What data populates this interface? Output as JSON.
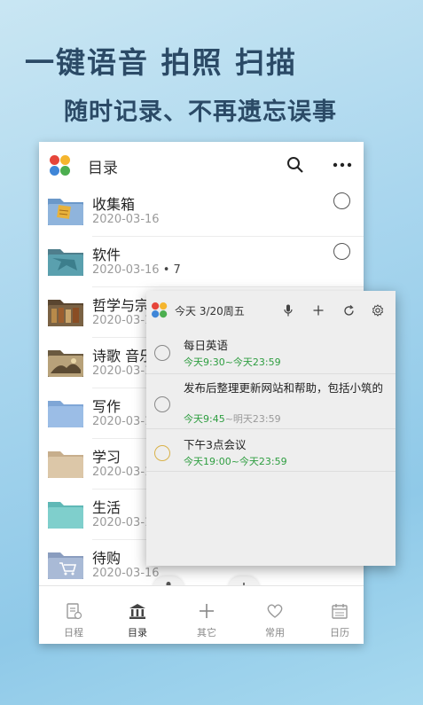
{
  "promo": {
    "headline": "一键语音 拍照 扫描",
    "subheadline": "随时记录、不再遗忘误事"
  },
  "app": {
    "title": "目录",
    "search_icon": "search-icon",
    "more_icon": "more-dots-icon"
  },
  "folders": [
    {
      "name": "收集箱",
      "date": "2020-03-16",
      "count": "",
      "icon": "inbox-folder"
    },
    {
      "name": "软件",
      "date": "2020-03-16",
      "count": "• 7",
      "icon": "software-folder"
    },
    {
      "name": "哲学与宗",
      "date": "2020-03-16",
      "count": "",
      "icon": "philosophy-folder"
    },
    {
      "name": "诗歌 音乐",
      "date": "2020-03-16",
      "count": "",
      "icon": "poetry-folder"
    },
    {
      "name": "写作",
      "date": "2020-03-16",
      "count": "",
      "icon": "folder"
    },
    {
      "name": "学习",
      "date": "2020-03-16",
      "count": "",
      "icon": "folder"
    },
    {
      "name": "生活",
      "date": "2020-03-16",
      "count": "",
      "icon": "folder"
    },
    {
      "name": "待购",
      "date": "2020-03-16",
      "count": "",
      "icon": "cart-folder"
    }
  ],
  "bottom_nav": [
    {
      "label": "日程",
      "icon": "schedule-icon"
    },
    {
      "label": "目录",
      "icon": "catalog-icon"
    },
    {
      "label": "其它",
      "icon": "plus-icon"
    },
    {
      "label": "常用",
      "icon": "heart-icon"
    },
    {
      "label": "日历",
      "icon": "calendar-icon"
    }
  ],
  "widget": {
    "title": "今天  3/20周五",
    "tasks": [
      {
        "text": "每日英语",
        "time_start": "今天9:30",
        "time_sep": "~",
        "time_end": "今天23:59",
        "end_style": "green"
      },
      {
        "text": "发布后整理更新网站和帮助，包括小筑的",
        "time_start": "今天9:45",
        "time_sep": "~",
        "time_end": "明天23:59",
        "end_style": "grey"
      },
      {
        "text": "下午3点会议",
        "time_start": "今天19:00",
        "time_sep": "~",
        "time_end": "今天23:59",
        "end_style": "green"
      }
    ]
  },
  "colors": {
    "accent_green": "#2e9e40",
    "highlight_circle": "#d9b24a"
  }
}
